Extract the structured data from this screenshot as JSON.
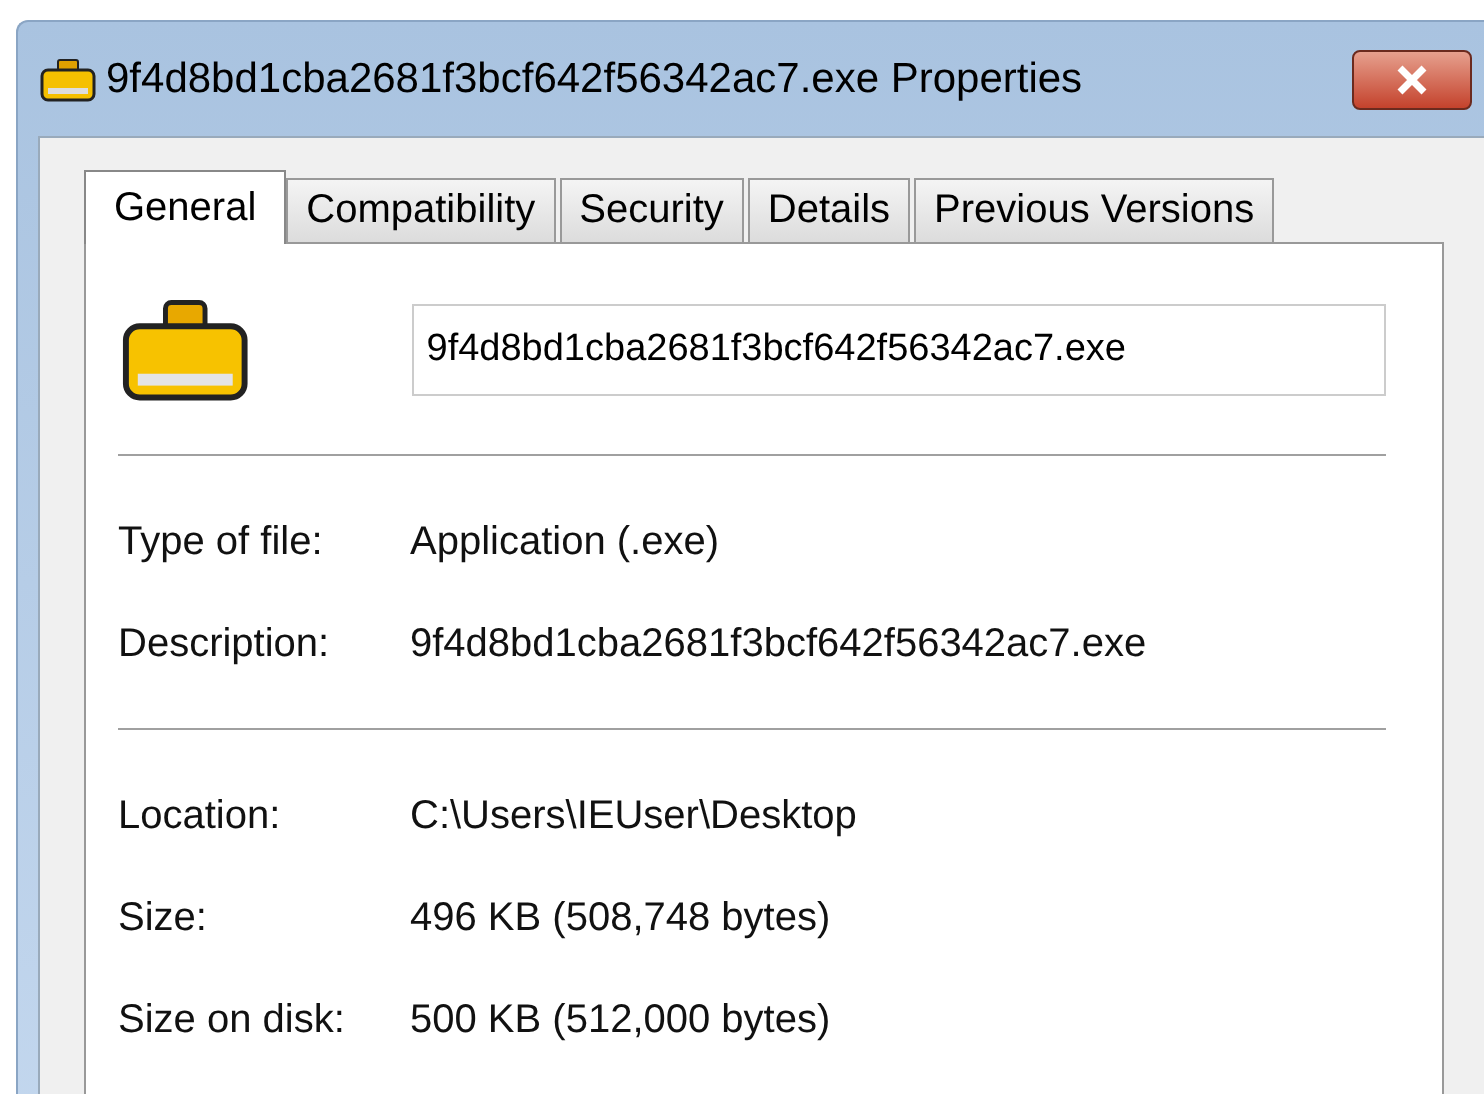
{
  "window": {
    "title": "9f4d8bd1cba2681f3bcf642f56342ac7.exe Properties"
  },
  "tabs": [
    {
      "label": "General",
      "selected": true
    },
    {
      "label": "Compatibility",
      "selected": false
    },
    {
      "label": "Security",
      "selected": false
    },
    {
      "label": "Details",
      "selected": false
    },
    {
      "label": "Previous Versions",
      "selected": false
    }
  ],
  "file_name": {
    "value": "9f4d8bd1cba2681f3bcf642f56342ac7.exe"
  },
  "groups": [
    [
      {
        "label": "Type of file:",
        "value": "Application (.exe)"
      },
      {
        "label": "Description:",
        "value": "9f4d8bd1cba2681f3bcf642f56342ac7.exe"
      }
    ],
    [
      {
        "label": "Location:",
        "value": "C:\\Users\\IEUser\\Desktop"
      },
      {
        "label": "Size:",
        "value": "496 KB (508,748 bytes)"
      },
      {
        "label": "Size on disk:",
        "value": "500 KB (512,000 bytes)"
      }
    ]
  ]
}
